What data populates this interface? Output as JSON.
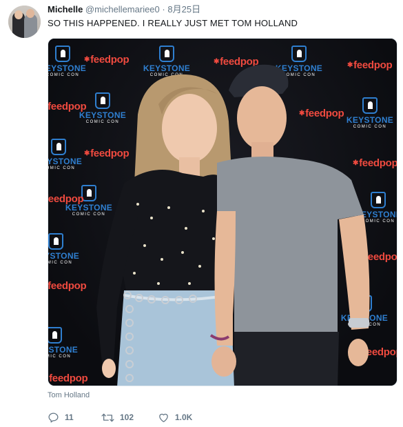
{
  "author": {
    "name": "Michelle",
    "handle": "@michellemariee0",
    "separator": "·",
    "date": "8月25日"
  },
  "tweet": {
    "text": "SO THIS HAPPENED. I REALLY JUST MET TOM HOLLAND"
  },
  "media": {
    "backdrop_logo_texts": [
      "feedpop",
      "KEYSTONE",
      "COMIC CON"
    ],
    "colors": {
      "feedpop": "#ef4a3f",
      "keystone": "#2f7fd0",
      "backdrop": "#0e0f14"
    }
  },
  "tag": "Tom Holland",
  "actions": {
    "reply": {
      "icon": "reply-icon",
      "count": "11"
    },
    "retweet": {
      "icon": "retweet-icon",
      "count": "102"
    },
    "like": {
      "icon": "heart-icon",
      "count": "1.0K"
    }
  }
}
